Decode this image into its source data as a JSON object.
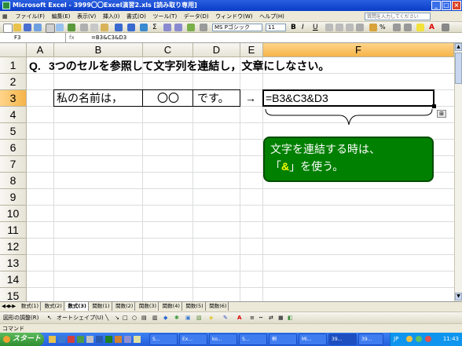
{
  "window": {
    "title": "Microsoft Excel - 3999〇〇Excel演習2.xls [読み取り専用]",
    "buttons": [
      "_",
      "□",
      "×"
    ]
  },
  "menu": {
    "items": [
      "ファイル(F)",
      "編集(E)",
      "表示(V)",
      "挿入(I)",
      "書式(O)",
      "ツール(T)",
      "データ(D)",
      "ウィンドウ(W)",
      "ヘルプ(H)"
    ],
    "help_placeholder": "質問を入力してください"
  },
  "toolbar": {
    "font": "MS Pゴシック",
    "size": "11",
    "bold": "B",
    "italic": "I",
    "underline": "U"
  },
  "formula_bar": {
    "name_box": "F3",
    "fx": "fx",
    "formula": "=B3&C3&D3"
  },
  "columns": [
    "A",
    "B",
    "C",
    "D",
    "E",
    "F"
  ],
  "selected_column": "F",
  "rows": [
    "1",
    "2",
    "3",
    "4",
    "5",
    "6",
    "7",
    "8",
    "9",
    "10",
    "11",
    "12",
    "13",
    "14",
    "15"
  ],
  "selected_row": "3",
  "cells": {
    "a1": "Q.",
    "b1": "3つのセルを参照して文字列を連結し，文章にしなさい。",
    "b3": "私の名前は，",
    "c3": "〇〇",
    "d3": "です。",
    "e3": "→",
    "f3": "=B3&C3&D3"
  },
  "callout": {
    "line1": "文字を連結する時は、",
    "line2_prefix": "「",
    "highlight": "&",
    "line2_suffix": "」を使う。",
    "fill_color": "#008000",
    "highlight_color": "#ffff00"
  },
  "sheet_tabs": [
    "数式(1)",
    "数式(2)",
    "数式(3)",
    "関数(1)",
    "関数(2)",
    "関数(3)",
    "関数(4)",
    "関数(5)",
    "関数(6)"
  ],
  "active_tab": "数式(3)",
  "draw_toolbar": {
    "draw": "図形の調整(R)",
    "autoshape": "オートシェイプ(U)"
  },
  "status": "コマンド",
  "taskbar": {
    "start": "スタート",
    "tasks": [
      "S...",
      "Ex...",
      "ko...",
      "S...",
      "桐",
      "Mi...",
      "39...",
      "39..."
    ],
    "tray_lang": "JP",
    "clock": "11:43"
  }
}
